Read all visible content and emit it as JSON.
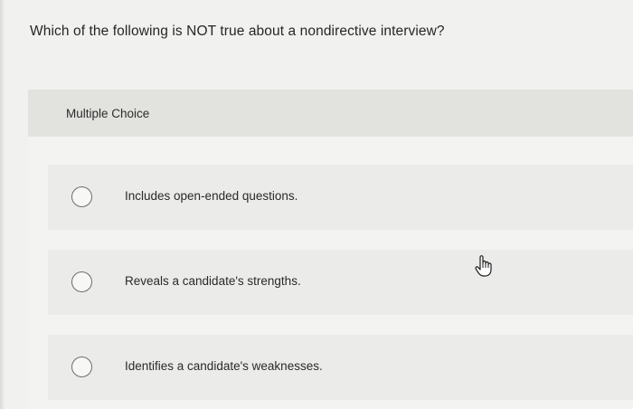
{
  "question": {
    "text": "Which of the following is NOT true about a nondirective interview?"
  },
  "panel": {
    "header": "Multiple Choice"
  },
  "options": [
    {
      "label": "Includes open-ended questions."
    },
    {
      "label": "Reveals a candidate's strengths."
    },
    {
      "label": "Identifies a candidate's weaknesses."
    }
  ],
  "cursor": {
    "icon": "hand-pointer-icon"
  },
  "colors": {
    "background": "#f1f1ef",
    "header_band": "#e2e2df",
    "option_band": "#ebebe9",
    "radio_border": "#6d6d6d"
  }
}
